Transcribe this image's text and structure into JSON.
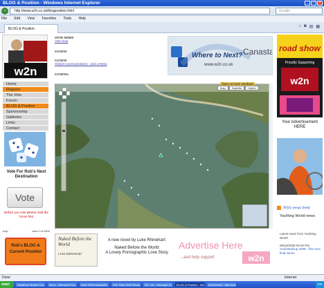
{
  "window": {
    "title": "BLOG & Position - Windows Internet Explorer",
    "address": "http://www.w2n.co.uk/blogposition.html",
    "search_placeholder": "Google"
  },
  "menu": [
    "File",
    "Edit",
    "View",
    "Favorites",
    "Tools",
    "Help"
  ],
  "tab": {
    "label": "BLOG & Position"
  },
  "left": {
    "logo_text": "w2n",
    "nav": [
      {
        "label": "Home",
        "highlight": false
      },
      {
        "label": "Register",
        "highlight": true
      },
      {
        "label": "The Vote",
        "highlight": false
      },
      {
        "label": "Forum",
        "highlight": false
      },
      {
        "label": "BLOG & Position",
        "highlight": true
      },
      {
        "label": "Sponsorship",
        "highlight": false
      },
      {
        "label": "Galleries",
        "highlight": false
      },
      {
        "label": "Links",
        "highlight": false
      },
      {
        "label": "Contact",
        "highlight": false
      }
    ],
    "vote_heading": "Vote For Rob's Next Destination",
    "vote_button": "Vote",
    "vote_note": "Before you vote please read the forum first",
    "help": "help",
    "help_right": "view 0 of 0000",
    "blog_button": "Rob's BLOG & Current Position"
  },
  "middle": {
    "vote_now_title": "VOTE NOW!!",
    "vote_link": "Vote Now",
    "entries": [
      {
        "date": "01/09/09",
        "text": ""
      },
      {
        "date": "01/09/09",
        "text": "Global Communications - and a Mesa"
      },
      {
        "date": "01/08/09a",
        "text": ""
      }
    ],
    "banner_text": "Where to Next?",
    "banner_sub": "www.w2n.co.uk",
    "banner_brand": "Canasta",
    "map_open_bigger": "Open at more windows",
    "map_types": [
      "Map",
      "Satellite",
      "Hybrid"
    ],
    "book_title": "Naked Before the World",
    "book_author": "LUKE RHINEHART",
    "novel_line1": "A new novel by Luke Rhinehart:",
    "novel_line2": "Naked Before the World:",
    "novel_line3": "A Lovely Pornographic Love Story.",
    "advertise": "Advertise Here",
    "advertise_sub": "...and help support",
    "advertise_logo": "w2n"
  },
  "right": {
    "roadshow": "road show",
    "roadshow_sub": "Proudly Supporting",
    "your_ad": "Your Advertisement HERE",
    "rss_title": "RSS news feed",
    "yw_title": "Yachting World news",
    "yw_desc": "Latest news from Yachting World",
    "yw_date": "08/16/2008 09:40 PM",
    "yw_item": "Audi Medcup 2008 - first race, final series"
  },
  "status": {
    "text": "Done",
    "zone": "Internet"
  },
  "taskbar": {
    "start": "start",
    "tasks": [
      "Vodafone Mobile Con...",
      "Inbox - Microsoft Out...",
      "Sixth W2N Newslette...",
      "FW: Sixth W2N Newsl...",
      "Re: Car - Message (H...",
      "BLOG & Position - Win...",
      "Document1 - Microsof..."
    ],
    "tray": "EN"
  },
  "colors": {
    "accent": "#f08c1c",
    "nav_bg": "#d8d8d8",
    "title_blue": "#1a4fc4"
  }
}
